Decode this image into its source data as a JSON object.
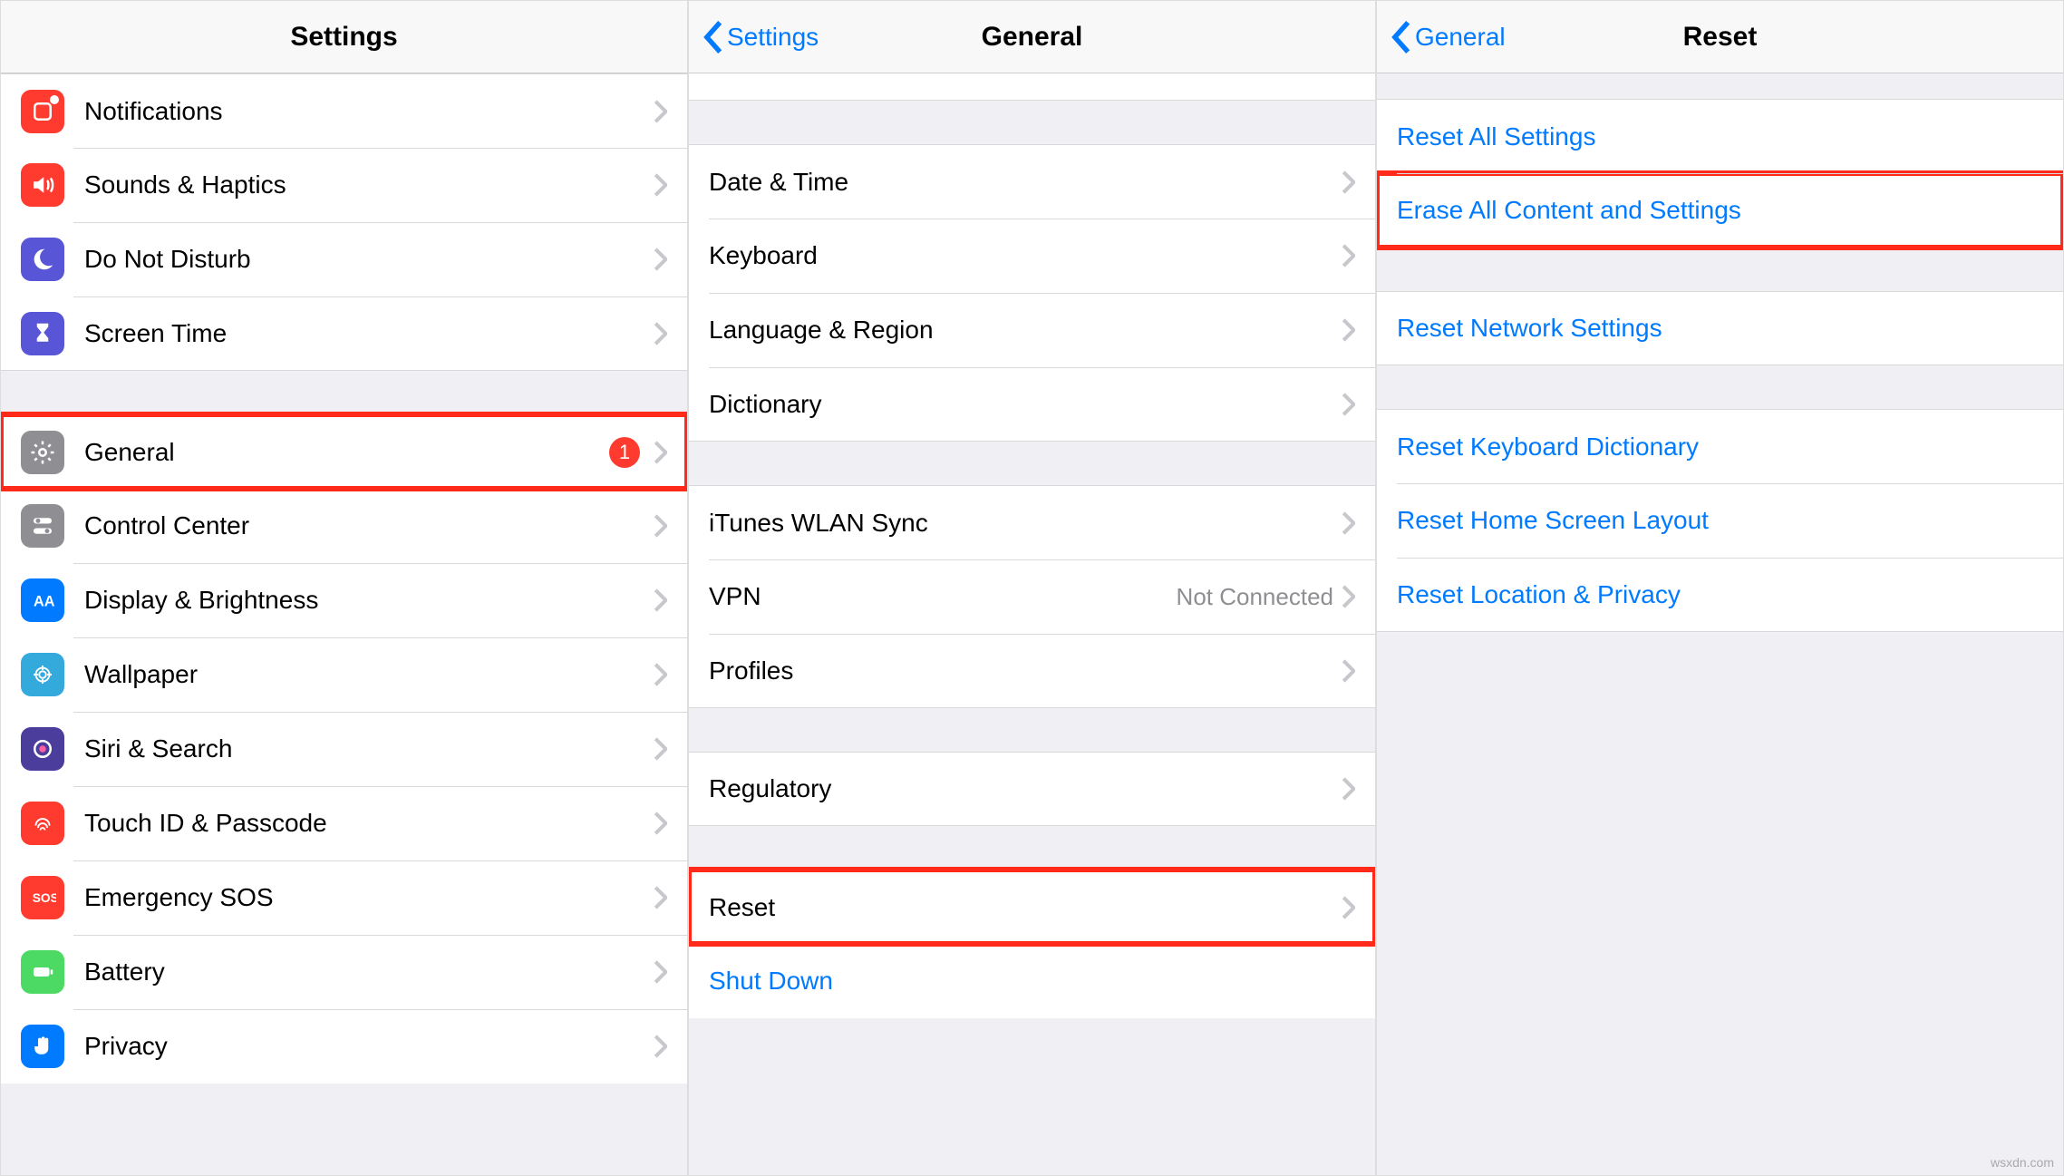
{
  "panelA": {
    "title": "Settings",
    "rows1": [
      {
        "name": "notifications",
        "label": "Notifications"
      },
      {
        "name": "sounds-haptics",
        "label": "Sounds & Haptics"
      },
      {
        "name": "do-not-disturb",
        "label": "Do Not Disturb"
      },
      {
        "name": "screen-time",
        "label": "Screen Time"
      }
    ],
    "rows2": [
      {
        "name": "general",
        "label": "General",
        "badge": "1",
        "highlight": true
      },
      {
        "name": "control-center",
        "label": "Control Center"
      },
      {
        "name": "display-brightness",
        "label": "Display & Brightness"
      },
      {
        "name": "wallpaper",
        "label": "Wallpaper"
      },
      {
        "name": "siri-search",
        "label": "Siri & Search"
      },
      {
        "name": "touchid-passcode",
        "label": "Touch ID & Passcode"
      },
      {
        "name": "emergency-sos",
        "label": "Emergency SOS"
      },
      {
        "name": "battery",
        "label": "Battery"
      },
      {
        "name": "privacy",
        "label": "Privacy"
      }
    ]
  },
  "panelB": {
    "back": "Settings",
    "title": "General",
    "group1": [
      {
        "name": "date-time",
        "label": "Date & Time"
      },
      {
        "name": "keyboard",
        "label": "Keyboard"
      },
      {
        "name": "language-region",
        "label": "Language & Region"
      },
      {
        "name": "dictionary",
        "label": "Dictionary"
      }
    ],
    "group2": [
      {
        "name": "itunes-wlan-sync",
        "label": "iTunes WLAN Sync"
      },
      {
        "name": "vpn",
        "label": "VPN",
        "detail": "Not Connected"
      },
      {
        "name": "profiles",
        "label": "Profiles"
      }
    ],
    "group3": [
      {
        "name": "regulatory",
        "label": "Regulatory"
      }
    ],
    "group4": [
      {
        "name": "reset",
        "label": "Reset",
        "highlight": true
      },
      {
        "name": "shut-down",
        "label": "Shut Down",
        "link": true,
        "noChevron": true
      }
    ]
  },
  "panelC": {
    "back": "General",
    "title": "Reset",
    "group1": [
      {
        "name": "reset-all-settings",
        "label": "Reset All Settings"
      },
      {
        "name": "erase-all-content",
        "label": "Erase All Content and Settings",
        "highlight": true
      }
    ],
    "group2": [
      {
        "name": "reset-network",
        "label": "Reset Network Settings"
      }
    ],
    "group3": [
      {
        "name": "reset-keyboard-dict",
        "label": "Reset Keyboard Dictionary"
      },
      {
        "name": "reset-home-layout",
        "label": "Reset Home Screen Layout"
      },
      {
        "name": "reset-location-privacy",
        "label": "Reset Location & Privacy"
      }
    ]
  },
  "watermark": "wsxdn.com"
}
